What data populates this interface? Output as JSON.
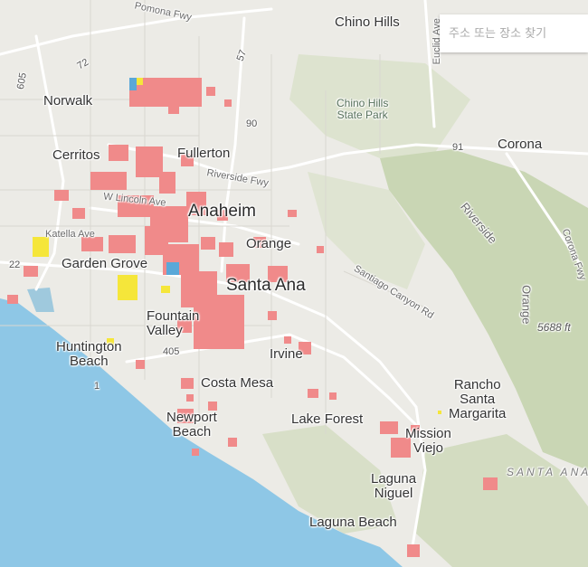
{
  "search": {
    "placeholder": "주소 또는 장소 찾기"
  },
  "colors": {
    "ocean": "#8ec7e6",
    "land": "#ecebe6",
    "hills": "#c9d6b4",
    "freeway": "#ffffff",
    "zone_red": "#f08a8a",
    "zone_yellow": "#f5e63a",
    "zone_blue": "#5aa8d8"
  },
  "labels": {
    "chino_hills": "Chino Hills",
    "chino_hills_state_park": "Chino Hills\nState Park",
    "norwalk": "Norwalk",
    "cerritos": "Cerritos",
    "fullerton": "Fullerton",
    "anaheim": "Anaheim",
    "orange": "Orange",
    "garden_grove": "Garden Grove",
    "santa_ana": "Santa Ana",
    "fountain_valley": "Fountain\nValley",
    "huntington_beach": "Huntington\nBeach",
    "irvine": "Irvine",
    "costa_mesa": "Costa Mesa",
    "newport_beach": "Newport\nBeach",
    "lake_forest": "Lake Forest",
    "rancho_santa_margarita": "Rancho\nSanta\nMargarita",
    "mission_viejo": "Mission\nViejo",
    "laguna_niguel": "Laguna\nNiguel",
    "laguna_beach": "Laguna Beach",
    "corona": "Corona",
    "pomona_fwy": "Pomona Fwy",
    "riverside_fwy": "Riverside Fwy",
    "lincoln_ave": "W Lincoln Ave",
    "katella_ave": "Katella Ave",
    "santiago_canyon_rd": "Santiago Canyon Rd",
    "riverside": "Riverside",
    "orange_county_line": "Orange",
    "corona_fwy": "Corona Fwy",
    "euclid_ave": "Euclid Ave",
    "santa_ana_mtns": "SANTA ANA",
    "elevation": "5688 ft",
    "hwy_605": "605",
    "hwy_72": "72",
    "hwy_57": "57",
    "hwy_90": "90",
    "hwy_91": "91",
    "hwy_22": "22",
    "hwy_405": "405",
    "hwy_1": "1"
  }
}
